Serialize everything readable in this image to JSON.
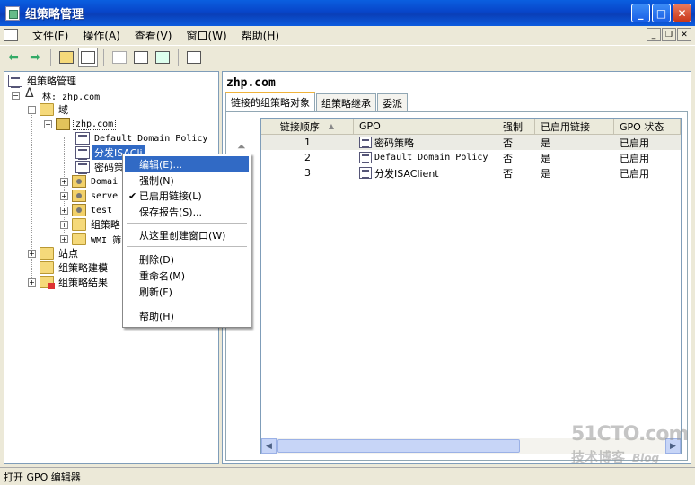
{
  "window": {
    "title": "组策略管理"
  },
  "menubar": {
    "items": [
      "文件(F)",
      "操作(A)",
      "查看(V)",
      "窗口(W)",
      "帮助(H)"
    ]
  },
  "tree": {
    "root": "组策略管理",
    "forest": "林: zhp.com",
    "domains": "域",
    "domain": "zhp.com",
    "children": [
      "Default Domain Policy",
      "分发ISAClient",
      "密码策略",
      "Domain Controllers",
      "servers",
      "test",
      "组策略对象",
      "WMI 筛选器"
    ],
    "children_visible": [
      "Default Domain Policy",
      "分发ISACli",
      "密码策",
      "Domai",
      "serve",
      "test",
      "组策略",
      "WMI 筛"
    ],
    "sites": "站点",
    "modeling": "组策略建模",
    "results": "组策略结果"
  },
  "right": {
    "title": "zhp.com",
    "tabs": [
      "链接的组策略对象",
      "组策略继承",
      "委派"
    ],
    "columns": [
      "链接顺序",
      "GPO",
      "强制",
      "已启用链接",
      "GPO 状态"
    ],
    "rows": [
      {
        "order": "1",
        "gpo": "密码策略",
        "enforced": "否",
        "link_enabled": "是",
        "status": "已启用"
      },
      {
        "order": "2",
        "gpo": "Default Domain Policy",
        "enforced": "否",
        "link_enabled": "是",
        "status": "已启用"
      },
      {
        "order": "3",
        "gpo": "分发ISAClient",
        "enforced": "否",
        "link_enabled": "是",
        "status": "已启用"
      }
    ]
  },
  "context_menu": {
    "items": [
      "编辑(E)...",
      "强制(N)",
      "已启用链接(L)",
      "保存报告(S)...",
      "从这里创建窗口(W)",
      "删除(D)",
      "重命名(M)",
      "刷新(F)",
      "帮助(H)"
    ]
  },
  "statusbar": {
    "text": "打开 GPO 编辑器"
  },
  "watermark": {
    "line1": "51CTO.com",
    "line2": "技术博客",
    "blog": "Blog"
  },
  "colors": {
    "titlebar": "#0a4fd0",
    "selection": "#316ac5",
    "chrome": "#ece9d8"
  }
}
